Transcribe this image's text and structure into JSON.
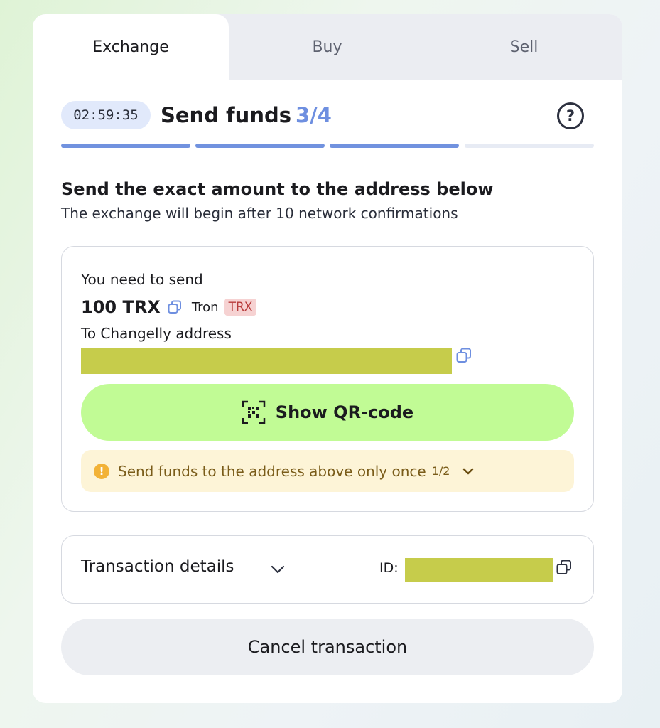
{
  "tabs": [
    {
      "label": "Exchange",
      "active": true
    },
    {
      "label": "Buy",
      "active": false
    },
    {
      "label": "Sell",
      "active": false
    }
  ],
  "step": {
    "timer": "02:59:35",
    "title": "Send funds",
    "count": "3/4",
    "completed_steps": 3,
    "total_steps": 4,
    "help_icon": "?"
  },
  "instructions": {
    "title": "Send the exact amount to the address below",
    "subtitle": "The exchange will begin after 10 network confirmations"
  },
  "send_box": {
    "need_label": "You need to send",
    "amount": "100 TRX",
    "network": "Tron",
    "ticker": "TRX",
    "to_label": "To Changelly address",
    "qr_button": "Show QR-code",
    "warning": "Send funds to the address above only once",
    "warning_count": "1/2"
  },
  "details": {
    "label": "Transaction details",
    "id_label": "ID:"
  },
  "cancel_button": "Cancel transaction",
  "colors": {
    "accent_blue": "#7192df",
    "qr_green": "#c1fb95",
    "warning_bg": "#fdf4d7",
    "ticker_bg": "#f6d2d2"
  }
}
